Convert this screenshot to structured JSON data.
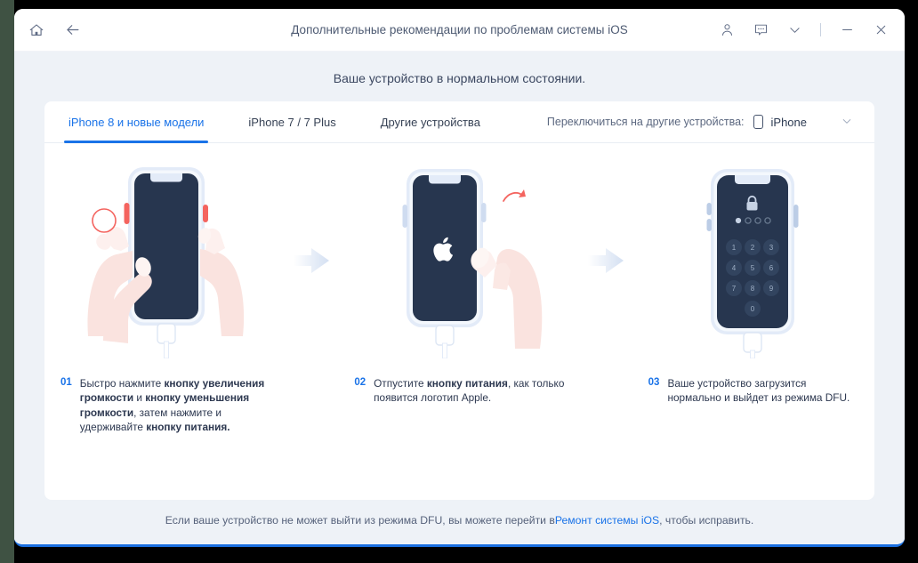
{
  "titlebar": {
    "home_icon": "home-icon",
    "back_icon": "back-arrow-icon",
    "title": "Дополнительные рекомендации по проблемам системы iOS",
    "account_icon": "user-account-icon",
    "feedback_icon": "feedback-chat-icon",
    "chevron_icon": "chevron-down-icon",
    "minimize_label": "—",
    "close_label": "✕"
  },
  "status": {
    "message": "Ваше устройство в нормальном состоянии."
  },
  "tabs": [
    {
      "label": "iPhone 8 и новые модели",
      "active": true
    },
    {
      "label": "iPhone 7 / 7 Plus",
      "active": false
    },
    {
      "label": "Другие устройства",
      "active": false
    }
  ],
  "switch_device": {
    "label": "Переключиться на другие устройства:",
    "value": "iPhone",
    "device_icon": "phone-icon",
    "caret_icon": "chevron-down-icon"
  },
  "steps": [
    {
      "number": "01",
      "illustration": "hands-holding-phone-pressing-volume-buttons",
      "text_parts": [
        {
          "t": "Быстро нажмите ",
          "b": false
        },
        {
          "t": "кнопку увеличения громкости",
          "b": true
        },
        {
          "t": " и ",
          "b": false
        },
        {
          "t": "кнопку уменьшения громкости",
          "b": true
        },
        {
          "t": ", затем нажмите и удерживайте ",
          "b": false
        },
        {
          "t": "кнопку питания.",
          "b": true
        }
      ]
    },
    {
      "number": "02",
      "illustration": "hand-releasing-power-button-apple-logo",
      "text_parts": [
        {
          "t": "Отпустите ",
          "b": false
        },
        {
          "t": "кнопку питания",
          "b": true
        },
        {
          "t": ", как только появится логотип Apple.",
          "b": false
        }
      ]
    },
    {
      "number": "03",
      "illustration": "phone-lock-screen-passcode-keypad",
      "text_parts": [
        {
          "t": "Ваше устройство загрузится нормально и выйдет из режима DFU.",
          "b": false
        }
      ]
    }
  ],
  "keypad": {
    "digits": [
      "1",
      "2",
      "3",
      "4",
      "5",
      "6",
      "7",
      "8",
      "9",
      "0"
    ],
    "dots_filled": 1,
    "dots_total": 4,
    "lock_icon": "lock-icon"
  },
  "arrows": {
    "icon": "right-arrow-icon",
    "count": 2
  },
  "footer": {
    "before": "Если ваше устройство не может выйти из режима DFU, вы можете перейти в ",
    "link": "Ремонт системы iOS",
    "after": ", чтобы исправить."
  },
  "colors": {
    "accent": "#1a73e8",
    "body_bg": "#eef2f7",
    "card_bg": "#ffffff",
    "screen_dark": "#27364f",
    "phone_frame": "#dbe4f2",
    "skin": "#fbe6e2",
    "button_red": "#f4someting"
  }
}
